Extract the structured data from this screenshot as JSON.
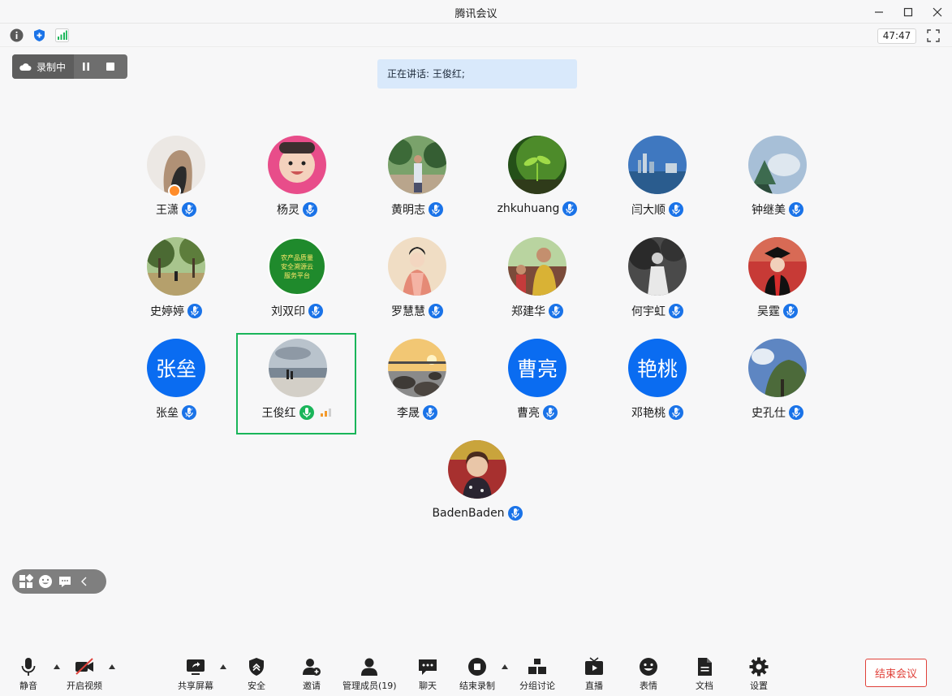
{
  "window": {
    "title": "腾讯会议"
  },
  "status": {
    "timer": "47:47"
  },
  "recording": {
    "label": "录制中"
  },
  "speaking": {
    "text": "正在讲话: 王俊红;"
  },
  "participants": [
    {
      "name": "王潇",
      "avatar": "photo-hair",
      "host": true
    },
    {
      "name": "杨灵",
      "avatar": "photo-baby"
    },
    {
      "name": "黄明志",
      "avatar": "photo-man-trees"
    },
    {
      "name": "zhkuhuang",
      "avatar": "photo-sprout"
    },
    {
      "name": "闫大顺",
      "avatar": "photo-city"
    },
    {
      "name": "钟继美",
      "avatar": "photo-sky"
    },
    {
      "name": "史婷婷",
      "avatar": "photo-park"
    },
    {
      "name": "刘双印",
      "avatar": "logo-green",
      "logo_text": [
        "农产品质量",
        "安全溯源云",
        "服务平台"
      ]
    },
    {
      "name": "罗慧慧",
      "avatar": "photo-painting"
    },
    {
      "name": "郑建华",
      "avatar": "photo-family"
    },
    {
      "name": "何宇虹",
      "avatar": "photo-bw"
    },
    {
      "name": "吴霆",
      "avatar": "photo-graduate"
    },
    {
      "name": "张垒",
      "avatar": "letter",
      "letter": "张垒"
    },
    {
      "name": "王俊红",
      "avatar": "photo-beach",
      "speaking": true
    },
    {
      "name": "李晟",
      "avatar": "photo-rocks"
    },
    {
      "name": "曹亮",
      "avatar": "letter",
      "letter": "曹亮"
    },
    {
      "name": "邓艳桃",
      "avatar": "letter",
      "letter": "艳桃"
    },
    {
      "name": "史孔仕",
      "avatar": "photo-treesky"
    },
    {
      "name": "BadenBaden",
      "avatar": "photo-child"
    }
  ],
  "toolbar": {
    "mute": "静音",
    "video": "开启视频",
    "share": "共享屏幕",
    "security": "安全",
    "invite": "邀请",
    "members": "管理成员(19)",
    "chat": "聊天",
    "end_record": "结束录制",
    "breakout": "分组讨论",
    "live": "直播",
    "reactions": "表情",
    "docs": "文档",
    "settings": "设置",
    "end_meeting": "结束会议"
  },
  "colors": {
    "accent": "#1a73e8",
    "active": "#1ab55a",
    "danger": "#e0413a",
    "letter_bg": "#0a6cf1"
  }
}
